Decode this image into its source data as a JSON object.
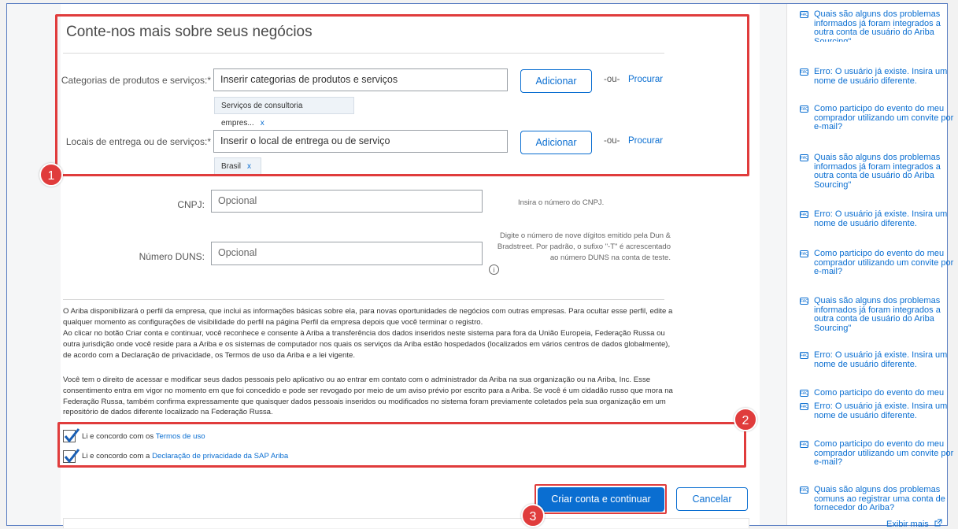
{
  "section": {
    "title": "Conte-nos mais sobre seus negócios"
  },
  "categories": {
    "label": "Categorias de produtos e serviços:*",
    "placeholder": "Inserir categorias de produtos e serviços",
    "add": "Adicionar",
    "or": "-ou-",
    "browse": "Procurar",
    "tag": "Serviços de consultoria empres...",
    "tag_remove": "x"
  },
  "locations": {
    "label": "Locais de entrega ou de serviços:*",
    "placeholder": "Inserir o local de entrega ou de serviço",
    "add": "Adicionar",
    "or": "-ou-",
    "browse": "Procurar",
    "tag": "Brasil",
    "tag_remove": "x"
  },
  "cnpj": {
    "label": "CNPJ:",
    "placeholder": "Opcional",
    "help": "Insira o número do CNPJ."
  },
  "duns": {
    "label": "Número DUNS:",
    "placeholder": "Opcional",
    "help": "Digite o número de nove dígitos emitido pela Dun & Bradstreet. Por padrão, o sufixo \"-T\" é acrescentado ao número DUNS na conta de teste.",
    "info": "i"
  },
  "legal": {
    "p1": "O Ariba disponibilizará o perfil da empresa, que inclui as informações básicas sobre ela, para novas oportunidades de negócios com outras empresas. Para ocultar esse perfil, edite a qualquer momento as configurações de visibilidade do perfil na página Perfil da empresa depois que você terminar o registro.",
    "p2": "Ao clicar no botão Criar conta e continuar, você reconhece e consente à Ariba a transferência dos dados inseridos neste sistema para fora da União Europeia, Federação Russa ou outra jurisdição onde você reside para a Ariba e os sistemas de computador nos quais os serviços da Ariba estão hospedados (localizados em vários centros de dados globalmente), de acordo com a Declaração de privacidade, os Termos de uso da Ariba e a lei vigente.",
    "p3": "Você tem o direito de acessar e modificar seus dados pessoais pelo aplicativo ou ao entrar em contato com o administrador da Ariba na sua organização ou na Ariba, Inc. Esse consentimento entra em vigor no momento em que foi concedido e pode ser revogado por meio de um aviso prévio por escrito para a Ariba. Se você é um cidadão russo que mora na Federação Russa, também confirma expressamente que quaisquer dados pessoais inseridos ou modificados no sistema foram previamente coletados pela sua organização em um repositório de dados diferente localizado na Federação Russa."
  },
  "consent": {
    "terms_prefix": "Li e concordo com os ",
    "terms_link": "Termos de uso",
    "privacy_prefix": "Li e concordo com a ",
    "privacy_link": "Declaração de privacidade da SAP Ariba"
  },
  "actions": {
    "create": "Criar conta e continuar",
    "cancel": "Cancelar"
  },
  "badges": [
    "1",
    "2",
    "3"
  ],
  "colors": {
    "accent": "#0a6ed1",
    "annotation": "#e03c3c"
  },
  "faq": {
    "items": [
      "Quais são alguns dos problemas informados já foram integrados a outra conta de usuário do Ariba Sourcing\"",
      "Erro: O usuário já existe. Insira um nome de usuário diferente.",
      "Como participo do evento do meu comprador utilizando um convite por e-mail?",
      "Quais são alguns dos problemas informados já foram integrados a outra conta de usuário do Ariba Sourcing\"",
      "Erro: O usuário já existe. Insira um nome de usuário diferente.",
      "Como participo do evento do meu comprador utilizando um convite por e-mail?",
      "Quais são alguns dos problemas informados já foram integrados a outra conta de usuário do Ariba Sourcing\"",
      "Erro: O usuário já existe. Insira um nome de usuário diferente.",
      "Como participo do evento do meu",
      "Erro: O usuário já existe. Insira um nome de usuário diferente.",
      "Como participo do evento do meu comprador utilizando um convite por e-mail?",
      "Quais são alguns dos problemas comuns ao registrar uma conta de fornecedor do Ariba?"
    ],
    "icon_label": "FAQ",
    "more": "Exibir mais"
  }
}
